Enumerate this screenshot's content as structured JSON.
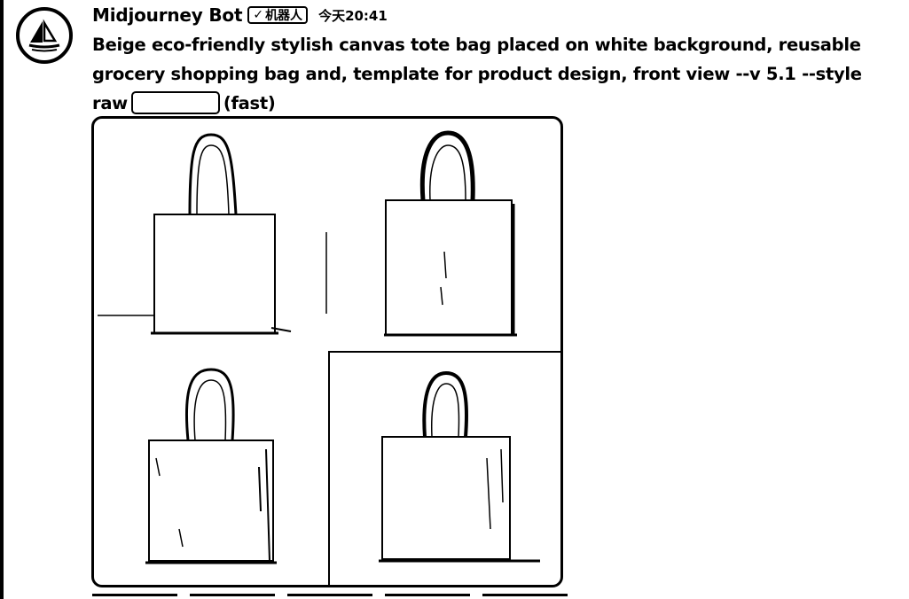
{
  "message": {
    "username": "Midjourney Bot",
    "badge": {
      "check": "✓",
      "label": "机器人"
    },
    "timestamp": "今天20:41",
    "prompt": "Beige eco-friendly stylish canvas tote bag placed on white background, reusable grocery shopping bag and, template for product design, front view --v 5.1 --style raw",
    "speed": "(fast)"
  },
  "image_grid": {
    "images": [
      "tote-bag-1",
      "tote-bag-2",
      "tote-bag-3",
      "tote-bag-4"
    ]
  },
  "colors": {
    "ink": "#000000",
    "paper": "#ffffff"
  },
  "icons": {
    "avatar": "midjourney-sailboat-icon",
    "badge": "check-icon"
  }
}
